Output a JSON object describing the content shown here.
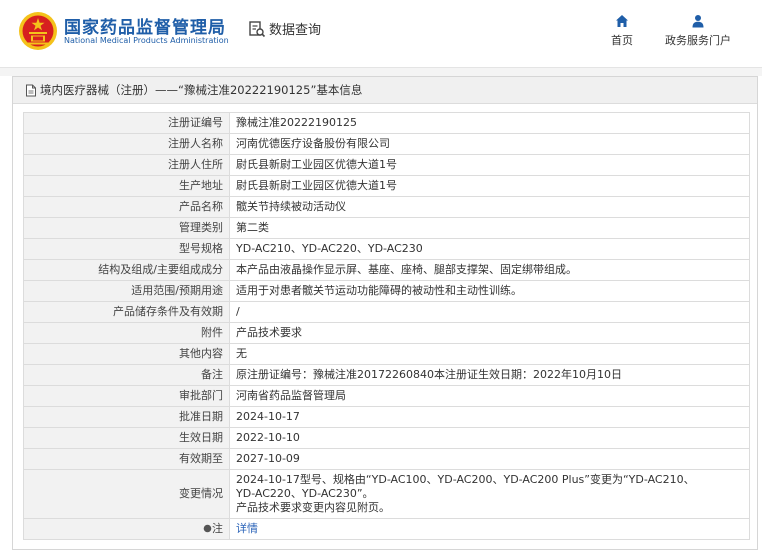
{
  "header": {
    "site_name_cn": "国家药品监督管理局",
    "site_name_en": "National Medical Products Administration",
    "query_label": "数据查询",
    "nav": [
      {
        "label": "首页",
        "icon": "home-icon"
      },
      {
        "label": "政务服务门户",
        "icon": "user-icon"
      }
    ]
  },
  "panel": {
    "title": "境内医疗器械（注册）——“豫械注准20222190125”基本信息"
  },
  "details": {
    "rows": [
      {
        "label": "注册证编号",
        "value": "豫械注准20222190125"
      },
      {
        "label": "注册人名称",
        "value": "河南优德医疗设备股份有限公司"
      },
      {
        "label": "注册人住所",
        "value": "尉氏县新尉工业园区优德大道1号"
      },
      {
        "label": "生产地址",
        "value": "尉氏县新尉工业园区优德大道1号"
      },
      {
        "label": "产品名称",
        "value": "髋关节持续被动活动仪"
      },
      {
        "label": "管理类别",
        "value": "第二类"
      },
      {
        "label": "型号规格",
        "value": "YD-AC210、YD-AC220、YD-AC230"
      },
      {
        "label": "结构及组成/主要组成成分",
        "value": "本产品由液晶操作显示屏、基座、座椅、腿部支撑架、固定绑带组成。"
      },
      {
        "label": "适用范围/预期用途",
        "value": "适用于对患者髋关节运动功能障碍的被动性和主动性训练。"
      },
      {
        "label": "产品储存条件及有效期",
        "value": "/"
      },
      {
        "label": "附件",
        "value": "产品技术要求"
      },
      {
        "label": "其他内容",
        "value": "无"
      },
      {
        "label": "备注",
        "value": "原注册证编号：豫械注准20172260840本注册证生效日期：2022年10月10日"
      },
      {
        "label": "审批部门",
        "value": "河南省药品监督管理局"
      },
      {
        "label": "批准日期",
        "value": "2024-10-17"
      },
      {
        "label": "生效日期",
        "value": "2022-10-10"
      },
      {
        "label": "有效期至",
        "value": "2027-10-09"
      }
    ],
    "change": {
      "label": "变更情况",
      "lines": [
        "2024-10-17型号、规格由“YD-AC100、YD-AC200、YD-AC200 Plus”变更为“YD-AC210、",
        "YD-AC220、YD-AC230”。",
        "产品技术要求变更内容见附页。"
      ]
    },
    "note": {
      "label": "注",
      "link": "详情"
    }
  },
  "colors": {
    "brand_blue": "#1f5ea8",
    "link_blue": "#2a63b8",
    "label_bg": "#f2f2f2",
    "emblem_red": "#d7201f",
    "emblem_gold": "#f4c21b"
  }
}
